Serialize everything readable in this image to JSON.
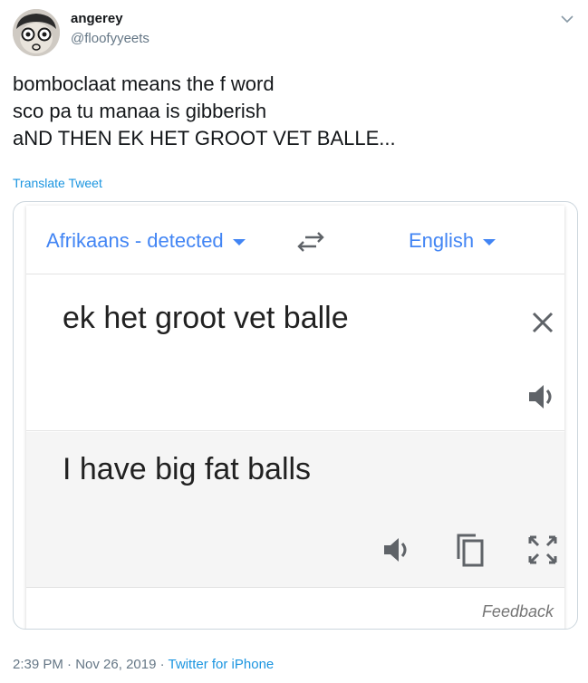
{
  "user": {
    "display_name": "angerey",
    "handle": "@floofyyeets"
  },
  "tweet": {
    "lines": [
      "bomboclaat means the f word",
      "sco pa tu manaa is gibberish",
      "aND THEN EK HET GROOT VET BALLE..."
    ],
    "translate_label": "Translate Tweet"
  },
  "translator": {
    "source_language": "Afrikaans - detected",
    "target_language": "English",
    "source_text": "ek het groot vet balle",
    "result_text": "I have big fat balls",
    "feedback_label": "Feedback",
    "accent_color": "#4285f4"
  },
  "footer": {
    "time": "2:39 PM",
    "separator": "·",
    "date": "Nov 26, 2019",
    "source": "Twitter for iPhone"
  },
  "icons": [
    "chevron-down-icon",
    "swap-languages-icon",
    "close-icon",
    "speaker-icon",
    "copy-icon",
    "fullscreen-icon"
  ]
}
